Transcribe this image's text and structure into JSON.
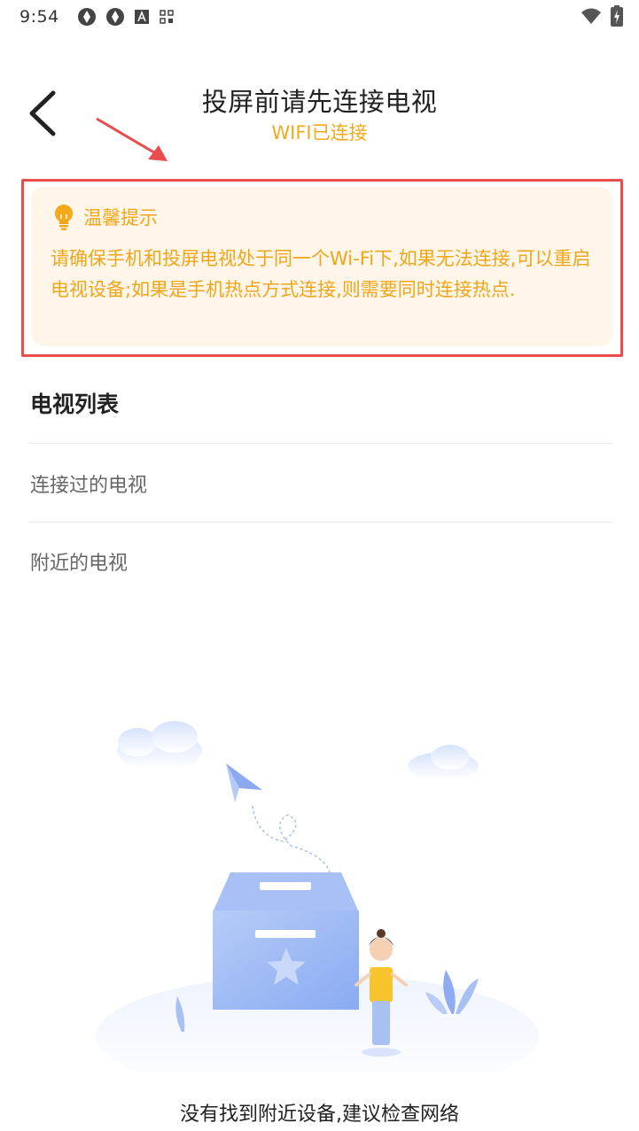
{
  "status_bar": {
    "time": "9:54"
  },
  "header": {
    "title": "投屏前请先连接电视",
    "subtitle": "WIFI已连接"
  },
  "tip": {
    "title": "温馨提示",
    "body": "请确保手机和投屏电视处于同一个Wi-Fi下,如果无法连接,可以重启电视设备;如果是手机热点方式连接,则需要同时连接热点."
  },
  "tv_list": {
    "title": "电视列表",
    "connected_label": "连接过的电视",
    "nearby_label": "附近的电视"
  },
  "empty_state": {
    "message": "没有找到附近设备,建议检查网络"
  },
  "colors": {
    "accent": "#f0a61a",
    "highlight_border": "#e94c4c",
    "tip_bg": "#fff5e9",
    "illustration_blue": "#8fb0f5"
  }
}
